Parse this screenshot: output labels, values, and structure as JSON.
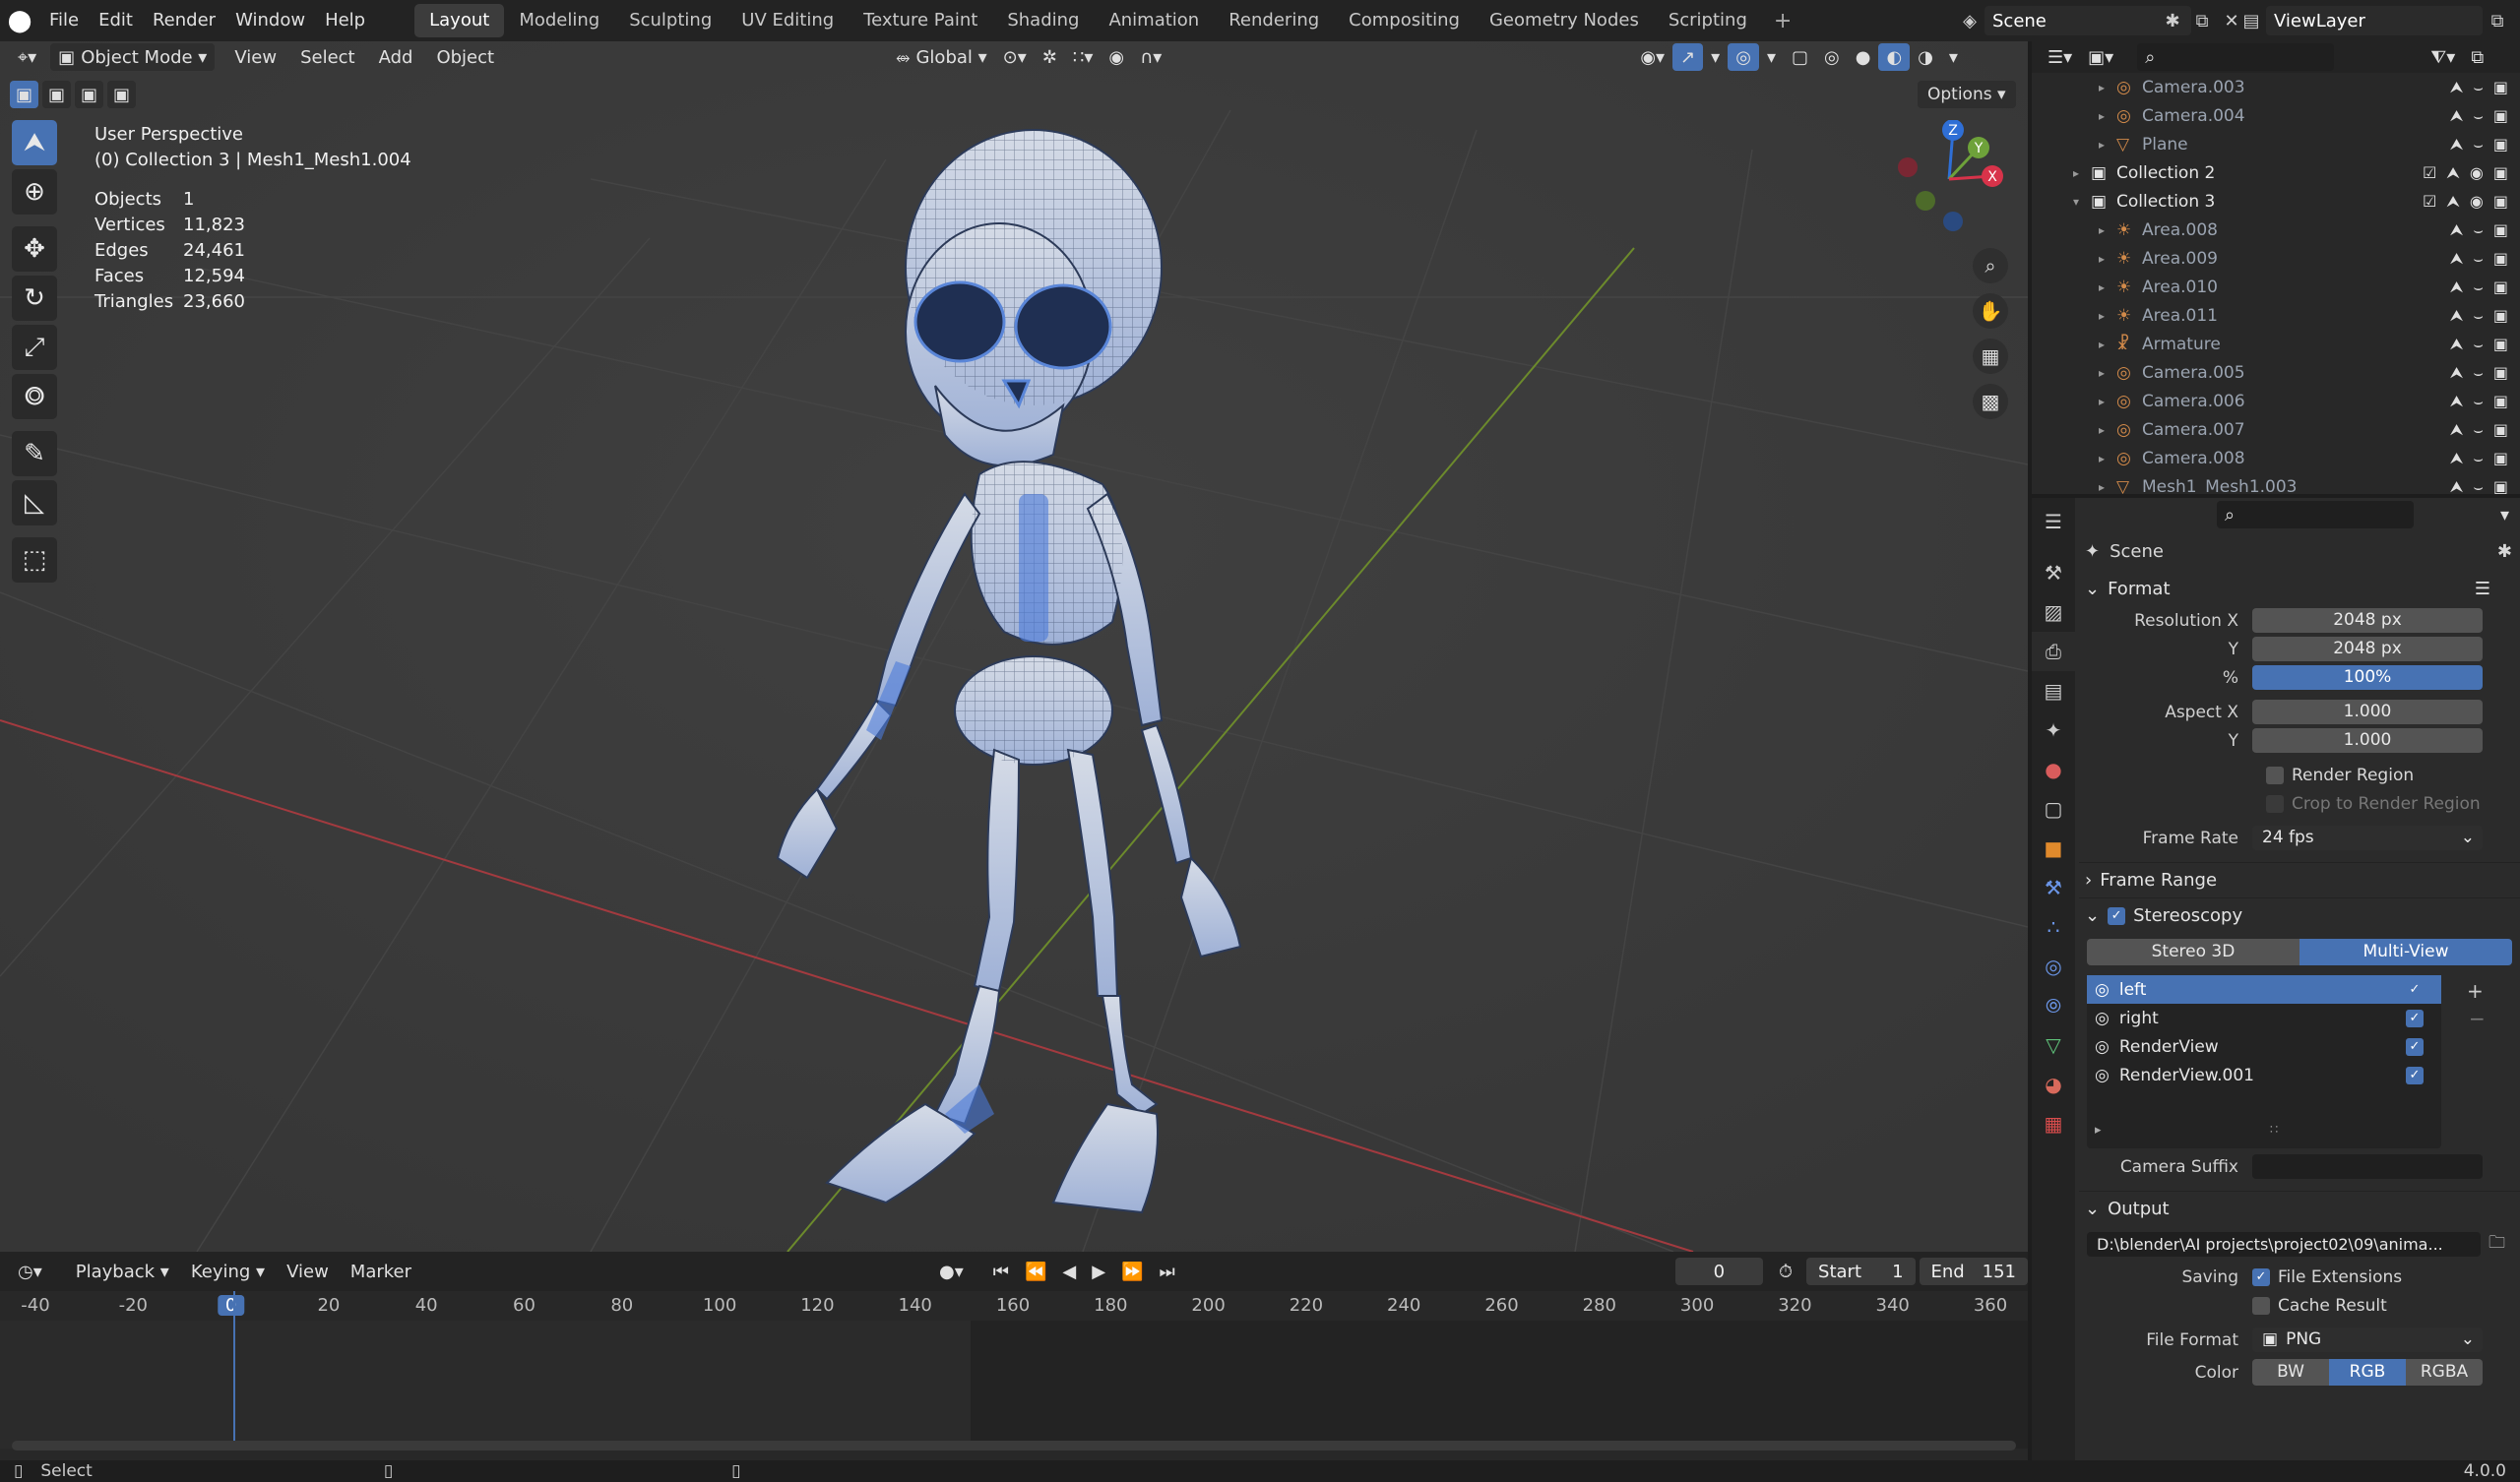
{
  "topbar": {
    "menus": [
      "File",
      "Edit",
      "Render",
      "Window",
      "Help"
    ],
    "workspaces": [
      "Layout",
      "Modeling",
      "Sculpting",
      "UV Editing",
      "Texture Paint",
      "Shading",
      "Animation",
      "Rendering",
      "Compositing",
      "Geometry Nodes",
      "Scripting"
    ],
    "active_workspace": "Layout",
    "scene": "Scene",
    "view_layer": "ViewLayer"
  },
  "viewport": {
    "mode": "Object Mode",
    "menus": [
      "View",
      "Select",
      "Add",
      "Object"
    ],
    "orientation": "Global",
    "options": "Options",
    "overlay_title": "User Perspective",
    "overlay_subtitle": "(0) Collection 3 | Mesh1_Mesh1.004",
    "stats": [
      {
        "label": "Objects",
        "value": "1"
      },
      {
        "label": "Vertices",
        "value": "11,823"
      },
      {
        "label": "Edges",
        "value": "24,461"
      },
      {
        "label": "Faces",
        "value": "12,594"
      },
      {
        "label": "Triangles",
        "value": "23,660"
      }
    ],
    "gizmo": {
      "z": "Z",
      "y": "Y",
      "x": "X"
    }
  },
  "timeline": {
    "menus": [
      "Playback",
      "Keying",
      "View",
      "Marker"
    ],
    "current_frame": "0",
    "start_label": "Start",
    "start": "1",
    "end_label": "End",
    "end": "151",
    "ruler": [
      "-40",
      "-20",
      "0",
      "20",
      "40",
      "60",
      "80",
      "100",
      "120",
      "140",
      "160",
      "180",
      "200",
      "220",
      "240",
      "260",
      "280",
      "300",
      "320",
      "340",
      "360"
    ]
  },
  "status": {
    "left": "Select",
    "version": "4.0.0"
  },
  "outliner": {
    "rows": [
      {
        "name": "Camera.003",
        "type": "camera",
        "level": 2
      },
      {
        "name": "Camera.004",
        "type": "camera",
        "level": 2
      },
      {
        "name": "Plane",
        "type": "mesh",
        "level": 2
      },
      {
        "name": "Collection 2",
        "type": "collection",
        "level": 1
      },
      {
        "name": "Collection 3",
        "type": "collection",
        "level": 1
      },
      {
        "name": "Area.008",
        "type": "light",
        "level": 2
      },
      {
        "name": "Area.009",
        "type": "light",
        "level": 2
      },
      {
        "name": "Area.010",
        "type": "light",
        "level": 2
      },
      {
        "name": "Area.011",
        "type": "light",
        "level": 2
      },
      {
        "name": "Armature",
        "type": "armature",
        "level": 2
      },
      {
        "name": "Camera.005",
        "type": "camera",
        "level": 2
      },
      {
        "name": "Camera.006",
        "type": "camera",
        "level": 2
      },
      {
        "name": "Camera.007",
        "type": "camera",
        "level": 2
      },
      {
        "name": "Camera.008",
        "type": "camera",
        "level": 2
      },
      {
        "name": "Mesh1_Mesh1.003",
        "type": "mesh",
        "level": 2
      }
    ]
  },
  "properties": {
    "context": "Scene",
    "format": {
      "title": "Format",
      "res_x_label": "Resolution X",
      "res_x": "2048 px",
      "res_y_label": "Y",
      "res_y": "2048 px",
      "pct_label": "%",
      "pct": "100%",
      "aspect_x_label": "Aspect X",
      "aspect_x": "1.000",
      "aspect_y_label": "Y",
      "aspect_y": "1.000",
      "render_region": "Render Region",
      "crop": "Crop to Render Region",
      "frame_rate_label": "Frame Rate",
      "frame_rate": "24 fps"
    },
    "frame_range": "Frame Range",
    "stereoscopy": {
      "title": "Stereoscopy",
      "mode_a": "Stereo 3D",
      "mode_b": "Multi-View",
      "views": [
        "left",
        "right",
        "RenderView",
        "RenderView.001"
      ],
      "camera_suffix_label": "Camera Suffix",
      "camera_suffix": ""
    },
    "output": {
      "title": "Output",
      "path": "D:\\blender\\AI projects\\project02\\09\\anima...",
      "saving_label": "Saving",
      "file_extensions": "File Extensions",
      "cache_result": "Cache Result",
      "file_format_label": "File Format",
      "file_format": "PNG",
      "color_label": "Color",
      "color_modes": [
        "BW",
        "RGB",
        "RGBA"
      ]
    }
  }
}
